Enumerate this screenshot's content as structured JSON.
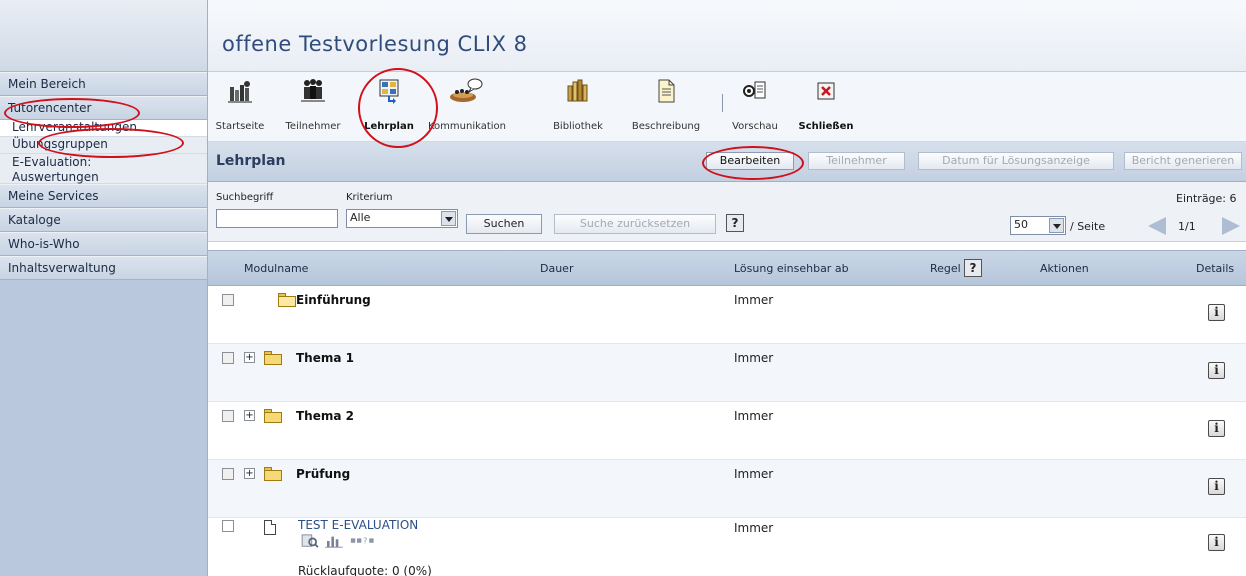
{
  "header": {
    "title": "offene Testvorlesung CLIX 8"
  },
  "sidebar": {
    "items": [
      {
        "label": "Mein Bereich"
      },
      {
        "label": "Tutorencenter"
      },
      {
        "label": "Lehrveranstaltungen"
      },
      {
        "label": "Übungsgruppen"
      },
      {
        "label": "E-Evaluation:",
        "label2": "Auswertungen"
      },
      {
        "label": "Meine Services"
      },
      {
        "label": "Kataloge"
      },
      {
        "label": "Who-is-Who"
      },
      {
        "label": "Inhaltsverwaltung"
      }
    ]
  },
  "toolbar": {
    "items": [
      {
        "label": "Startseite",
        "icon": "home-icon"
      },
      {
        "label": "Teilnehmer",
        "icon": "participants-icon"
      },
      {
        "label": "Lehrplan",
        "icon": "curriculum-icon",
        "active": true
      },
      {
        "label": "Kommunikation",
        "icon": "communication-icon"
      },
      {
        "label": "Bibliothek",
        "icon": "library-icon"
      },
      {
        "label": "Beschreibung",
        "icon": "description-icon"
      },
      {
        "label": "Vorschau",
        "icon": "preview-icon"
      },
      {
        "label": "Schließen",
        "icon": "close-icon"
      }
    ]
  },
  "section": {
    "title": "Lehrplan",
    "buttons": {
      "edit": "Bearbeiten",
      "participants": "Teilnehmer",
      "solution_date": "Datum für Lösungsanzeige",
      "report": "Bericht generieren"
    }
  },
  "search": {
    "term_label": "Suchbegriff",
    "term_value": "",
    "criterion_label": "Kriterium",
    "criterion_value": "Alle",
    "search_button": "Suchen",
    "reset_button": "Suche zurücksetzen",
    "help": "?",
    "entries": "Einträge: 6",
    "per_page_value": "50",
    "per_page_label": "/ Seite",
    "page": "1/1"
  },
  "table": {
    "columns": {
      "name": "Modulname",
      "duration": "Dauer",
      "solution": "Lösung einsehbar ab",
      "rule": "Regel",
      "actions": "Aktionen",
      "details": "Details"
    },
    "rows": [
      {
        "name": "Einführung",
        "solution": "Immer",
        "type": "folder-open"
      },
      {
        "name": "Thema 1",
        "solution": "Immer",
        "type": "folder"
      },
      {
        "name": "Thema 2",
        "solution": "Immer",
        "type": "folder"
      },
      {
        "name": "Prüfung",
        "solution": "Immer",
        "type": "folder"
      },
      {
        "name": "TEST E-EVALUATION",
        "solution": "Immer",
        "type": "document",
        "extra": "Rücklaufquote: 0 (0%)"
      }
    ],
    "info_label": "i"
  },
  "colors": {
    "annotation": "#d0101a",
    "title": "#2f4c7c",
    "sidebar": "#b9c8dc"
  }
}
